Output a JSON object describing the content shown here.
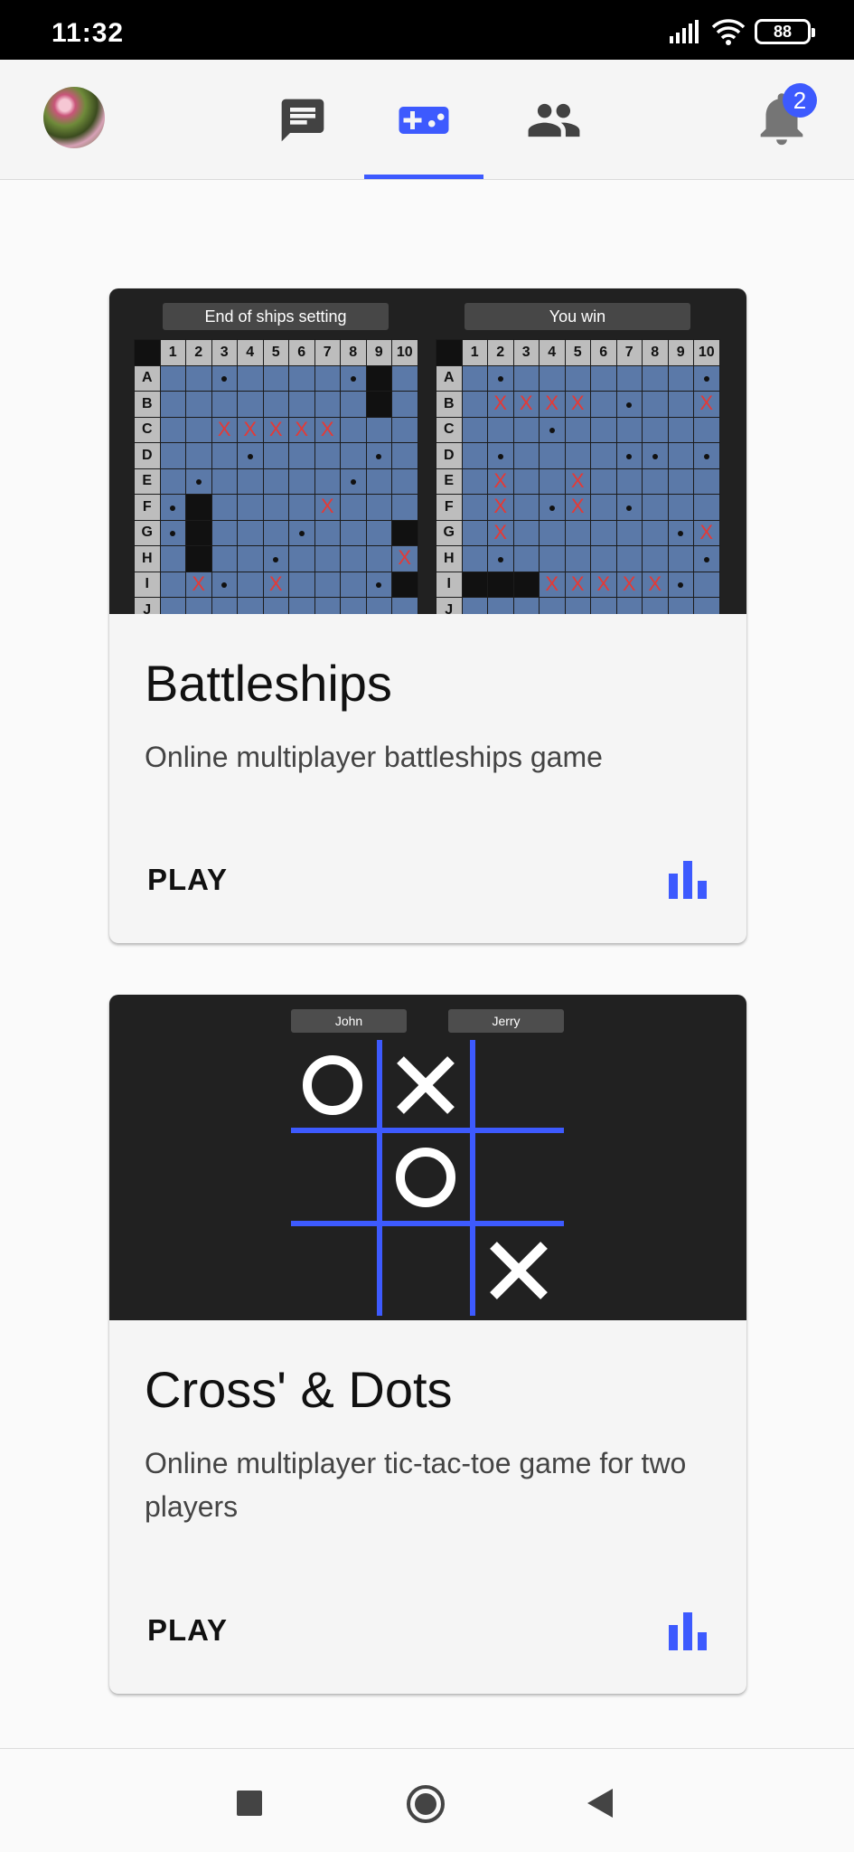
{
  "status_bar": {
    "time": "11:32",
    "battery": "88",
    "signal_icon": "signal-icon",
    "wifi_icon": "wifi-icon"
  },
  "app_bar": {
    "tabs": [
      {
        "name": "chat",
        "icon": "chat-icon",
        "selected": false
      },
      {
        "name": "games",
        "icon": "gamepad-icon",
        "selected": true
      },
      {
        "name": "friends",
        "icon": "people-icon",
        "selected": false
      }
    ],
    "notification_count": "2",
    "accent_color": "#3d5afe"
  },
  "games": [
    {
      "title": "Battleships",
      "description": "Online multiplayer battleships game",
      "play_label": "PLAY",
      "preview": {
        "left_label": "End of ships setting",
        "right_label": "You win",
        "columns": [
          "1",
          "2",
          "3",
          "4",
          "5",
          "6",
          "7",
          "8",
          "9",
          "10"
        ],
        "rows": [
          "A",
          "B",
          "C",
          "D",
          "E",
          "F",
          "G",
          "H",
          "I",
          "J"
        ]
      }
    },
    {
      "title": "Cross' & Dots",
      "description": "Online multiplayer tic-tac-toe game for two players",
      "play_label": "PLAY",
      "preview": {
        "player1": "John",
        "player2": "Jerry",
        "board": [
          "O",
          "X",
          "",
          "",
          "O",
          "",
          "",
          "",
          "X"
        ]
      }
    }
  ]
}
